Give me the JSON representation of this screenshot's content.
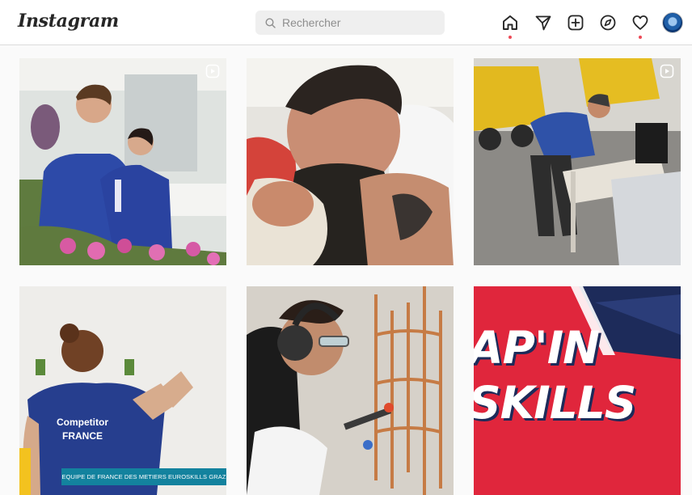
{
  "header": {
    "logo_text": "Instagram",
    "search_placeholder": "Rechercher",
    "search_value": "",
    "nav_icons": [
      "home-icon",
      "direct-icon",
      "new-post-icon",
      "explore-icon",
      "activity-icon",
      "avatar"
    ]
  },
  "colors": {
    "notification_dot": "#ed4956",
    "caption_bar": "#13829e",
    "zap_red": "#e0263c",
    "zap_navy": "#1d2b5a"
  },
  "posts": [
    {
      "type": "reel",
      "icon": "reel-icon"
    },
    {
      "type": "photo"
    },
    {
      "type": "reel",
      "icon": "reel-icon"
    },
    {
      "type": "photo",
      "jersey_line1": "Competitor",
      "jersey_line2": "FRANCE",
      "caption": "EQUIPE DE FRANCE DES METIERS EUROSKILLS GRAZ"
    },
    {
      "type": "photo"
    },
    {
      "type": "photo",
      "title_line1": "AP'IN",
      "title_line2": "SKILLS"
    }
  ]
}
